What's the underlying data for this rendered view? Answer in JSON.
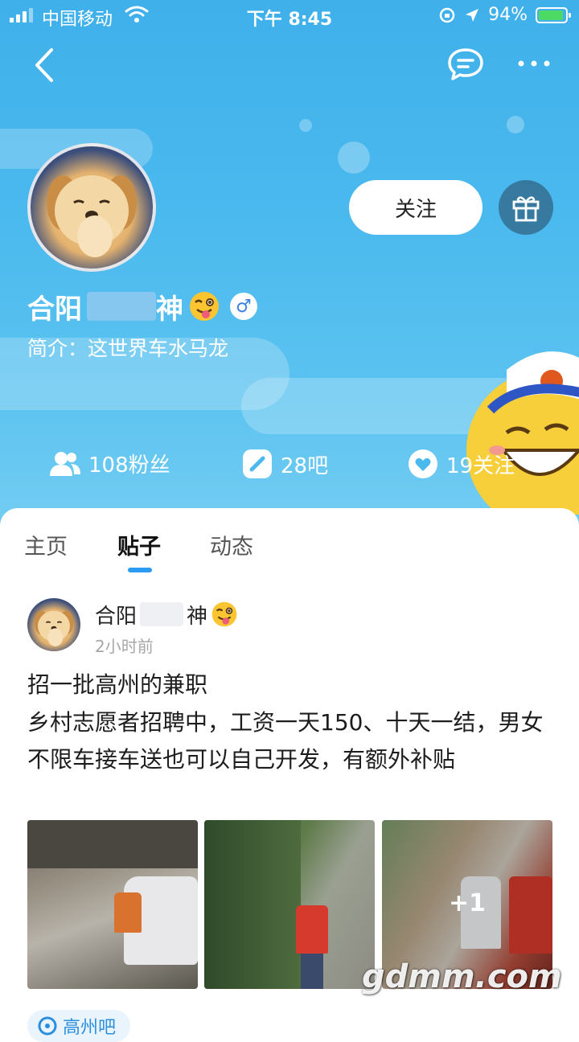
{
  "status_bar": {
    "carrier": "中国移动",
    "time": "下午 8:45",
    "battery_percent": "94%",
    "battery_level": 0.94,
    "icons": [
      "signal-icon",
      "wifi-icon",
      "rotation-lock-icon",
      "location-icon",
      "battery-icon"
    ]
  },
  "nav": {
    "icons": [
      "back-icon",
      "message-icon",
      "more-icon"
    ]
  },
  "profile": {
    "name_start": "合阳",
    "name_end": "神",
    "bio": "简介：这世界车水马龙",
    "follow_label": "关注",
    "gender_symbol": "♂",
    "stats": {
      "fans": "108粉丝",
      "bars": "28吧",
      "following": "19关注"
    }
  },
  "tabs": [
    {
      "label": "主页",
      "active": false
    },
    {
      "label": "贴子",
      "active": true
    },
    {
      "label": "动态",
      "active": false
    }
  ],
  "post": {
    "author_start": "合阳",
    "author_end": "神",
    "time": "2小时前",
    "title": "招一批高州的兼职",
    "body": "乡村志愿者招聘中，工资一天150、十天一结，男女不限车接车送也可以自己开发，有额外补贴",
    "more_images_label": "+1",
    "forum_label": "高州吧"
  },
  "watermark": "gdmm.com",
  "colors": {
    "hero_blue": "#4ab9ee",
    "accent_blue": "#2b9cf2",
    "male_blue": "#3b82e6",
    "battery_green": "#4cd964"
  }
}
